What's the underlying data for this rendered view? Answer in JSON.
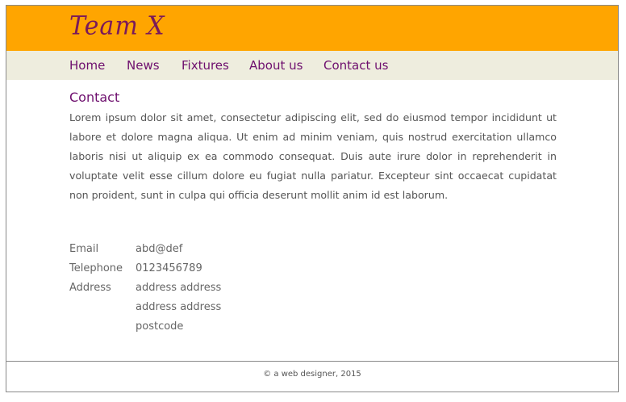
{
  "header": {
    "logo": "Team X",
    "background_color": "#ffa500",
    "logo_color": "#7a1a5a"
  },
  "nav": {
    "items": [
      {
        "label": "Home"
      },
      {
        "label": "News"
      },
      {
        "label": "Fixtures"
      },
      {
        "label": "About us"
      },
      {
        "label": "Contact us"
      }
    ],
    "background_color": "#eeedde",
    "link_color": "#6e0f6e"
  },
  "main": {
    "title": "Contact",
    "body": "Lorem ipsum dolor sit amet, consectetur adipiscing elit, sed do eiusmod tempor incididunt ut labore et dolore magna aliqua. Ut enim ad minim veniam, quis nostrud exercitation ullamco laboris nisi ut aliquip ex ea commodo consequat. Duis aute irure dolor in reprehenderit in voluptate velit esse cillum dolore eu fugiat nulla pariatur. Excepteur sint occaecat cupidatat non proident, sunt in culpa qui officia deserunt mollit anim id est laborum.",
    "contact": {
      "email_label": "Email",
      "email_value": "abd@def",
      "telephone_label": "Telephone",
      "telephone_value": "0123456789",
      "address_label": "Address",
      "address_lines": [
        "address address",
        "address address",
        "postcode"
      ]
    }
  },
  "footer": {
    "text": "© a web designer, 2015"
  }
}
